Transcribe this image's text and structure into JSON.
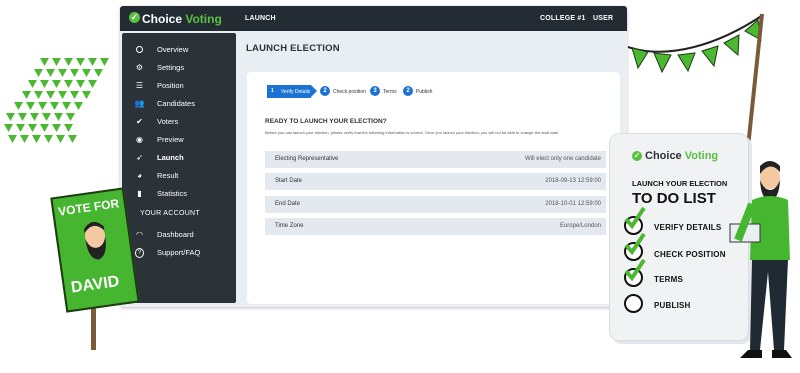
{
  "app": {
    "logo_part1": "Choice",
    "logo_part2": "Voting",
    "tab": "LAUNCH",
    "org": "COLLEGE #1",
    "user": "USER"
  },
  "sidebar": {
    "items": [
      {
        "label": "Overview",
        "icon": "circle-icon"
      },
      {
        "label": "Settings",
        "icon": "gear-icon"
      },
      {
        "label": "Position",
        "icon": "list-icon"
      },
      {
        "label": "Candidates",
        "icon": "users-icon"
      },
      {
        "label": "Voters",
        "icon": "check-badge-icon"
      },
      {
        "label": "Preview",
        "icon": "eye-icon"
      },
      {
        "label": "Launch",
        "icon": "rocket-icon"
      },
      {
        "label": "Result",
        "icon": "pie-icon"
      },
      {
        "label": "Statistics",
        "icon": "bar-chart-icon"
      }
    ],
    "section_label": "YOUR ACCOUNT",
    "account_items": [
      {
        "label": "Dashboard",
        "icon": "gauge-icon"
      },
      {
        "label": "Support/FAQ",
        "icon": "question-icon"
      }
    ],
    "active": "Launch"
  },
  "page": {
    "title": "LAUNCH ELECTION",
    "steps": [
      {
        "num": "1",
        "label": "Verify Details"
      },
      {
        "num": "2",
        "label": "Check position"
      },
      {
        "num": "3",
        "label": "Terms"
      },
      {
        "num": "2",
        "label": "Publish"
      }
    ],
    "question": "READY TO LAUNCH YOUR ELECTION?",
    "instructions": "Before you can launch your election, please verify that the following information is correct. Once you launch your election, you will not be able to change the start date.",
    "details": [
      {
        "key": "Electing Representative",
        "value": "Will elect only one candidate"
      },
      {
        "key": "Start Date",
        "value": "2018-09-13 12:59:00"
      },
      {
        "key": "End Date",
        "value": "2018-10-01 12:59:00"
      },
      {
        "key": "Time Zone",
        "value": "Europe/London"
      }
    ]
  },
  "todo": {
    "logo_part1": "Choice",
    "logo_part2": "Voting",
    "heading1": "LAUNCH YOUR ELECTION",
    "heading2": "TO DO LIST",
    "items": [
      {
        "label": "VERIFY DETAILS",
        "done": true
      },
      {
        "label": "CHECK POSITION",
        "done": true
      },
      {
        "label": "TERMS",
        "done": true
      },
      {
        "label": "PUBLISH",
        "done": false
      }
    ]
  },
  "sign": {
    "line1": "VOTE FOR",
    "line2": "DAVID"
  },
  "colors": {
    "accent_green": "#59c13f",
    "step_blue": "#1a73d3",
    "topbar": "#242c33",
    "sidebar": "#2b3238"
  }
}
